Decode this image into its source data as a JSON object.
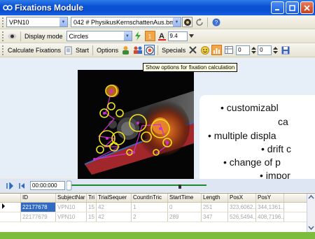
{
  "window": {
    "title": "Fixations Module"
  },
  "toolbar1": {
    "subject_value": "VPN10",
    "trial_value": "042 # PhysikusKernschattenAus.bmp"
  },
  "toolbar2": {
    "display_mode_label": "Display mode",
    "display_mode_value": "Circles",
    "font_size_value": "9.4"
  },
  "toolbar3": {
    "calculate_label": "Calculate Fixations",
    "start_label": "Start",
    "options_label": "Options",
    "specials_label": "Specials",
    "spin1_value": "0",
    "spin2_value": "0"
  },
  "tooltip": "Show options for fixation calculation",
  "overlay_lines": [
    "• customizabl",
    "ca",
    "• multiple displa",
    "• drift c",
    "• change of p",
    "• impor"
  ],
  "player": {
    "time": "00:00:000"
  },
  "grid": {
    "columns": [
      "ID",
      "SubjectNar",
      "Tri",
      "TrialSequer",
      "CountInTric",
      "StartTime",
      "Length",
      "PosX",
      "PosY"
    ],
    "rows": [
      [
        "22177678",
        "VPN10",
        "15",
        "42",
        "1",
        "0",
        "251",
        "323,6062...",
        "344,1361..."
      ],
      [
        "22177679",
        "VPN10",
        "15",
        "42",
        "2",
        "289",
        "347",
        "526,5494...",
        "408,7196..."
      ]
    ]
  },
  "colors": {
    "titlebar": "#0a52d6",
    "accent_bg": "#7cbd3d",
    "selection": "#316ac5"
  }
}
